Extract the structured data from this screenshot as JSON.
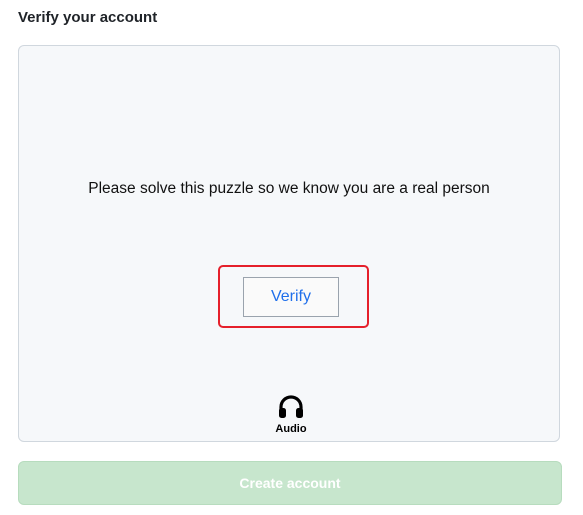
{
  "page": {
    "section_title": "Verify your account"
  },
  "captcha": {
    "instruction": "Please solve this puzzle so we know you are a real person",
    "verify_label": "Verify",
    "audio_label": "Audio",
    "audio_icon": "headphones-icon"
  },
  "form": {
    "create_account_label": "Create account",
    "create_account_enabled": false
  },
  "colors": {
    "highlight_border": "#e5202b",
    "verify_text": "#1f6feb",
    "create_button_bg_disabled": "#c7e6cd",
    "panel_bg": "#f6f8fa"
  }
}
